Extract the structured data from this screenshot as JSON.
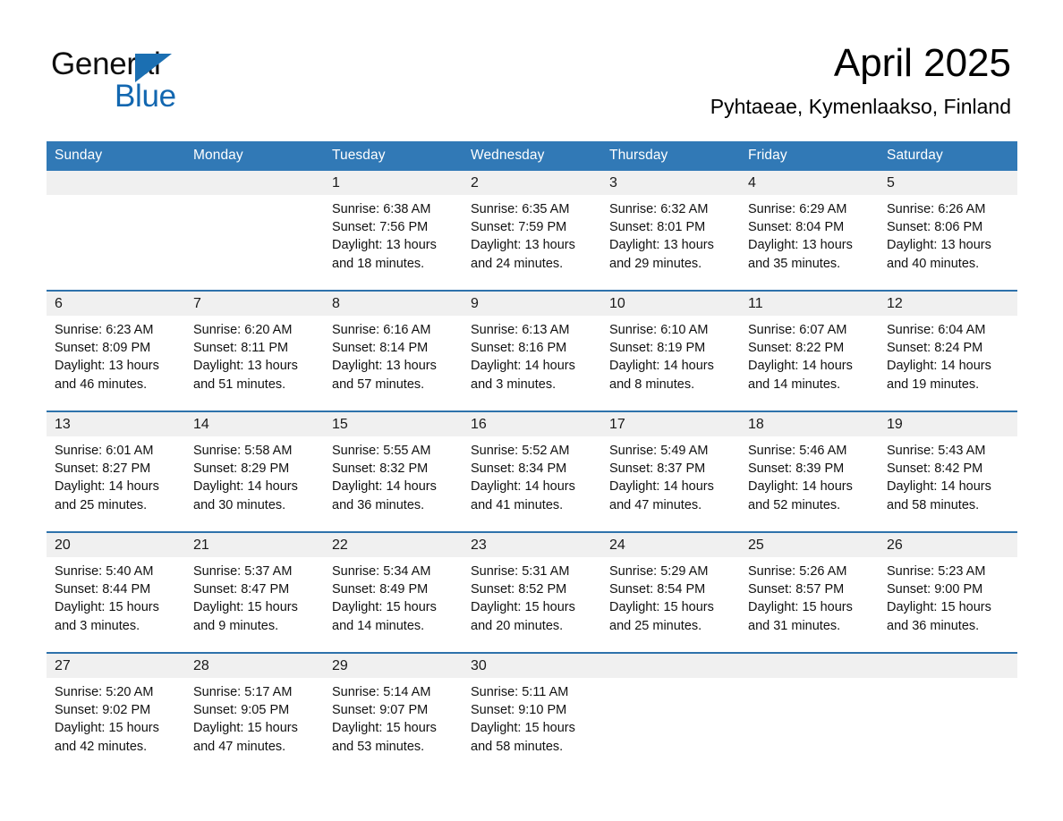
{
  "brand": {
    "name_part1": "General",
    "name_part2": "Blue",
    "accent_color": "#1267b0",
    "triangle_color": "#1b6fb2"
  },
  "header": {
    "month_title": "April 2025",
    "location": "Pyhtaeae, Kymenlaakso, Finland",
    "header_bar_color": "#3179b6",
    "row_divider_color": "#2e72ab",
    "daynum_band_color": "#f0f0f0"
  },
  "weekday_headers": [
    "Sunday",
    "Monday",
    "Tuesday",
    "Wednesday",
    "Thursday",
    "Friday",
    "Saturday"
  ],
  "weeks": [
    [
      {
        "day": "",
        "sunrise": "",
        "sunset": "",
        "daylight": "",
        "daylight2": ""
      },
      {
        "day": "",
        "sunrise": "",
        "sunset": "",
        "daylight": "",
        "daylight2": ""
      },
      {
        "day": "1",
        "sunrise": "Sunrise: 6:38 AM",
        "sunset": "Sunset: 7:56 PM",
        "daylight": "Daylight: 13 hours",
        "daylight2": "and 18 minutes."
      },
      {
        "day": "2",
        "sunrise": "Sunrise: 6:35 AM",
        "sunset": "Sunset: 7:59 PM",
        "daylight": "Daylight: 13 hours",
        "daylight2": "and 24 minutes."
      },
      {
        "day": "3",
        "sunrise": "Sunrise: 6:32 AM",
        "sunset": "Sunset: 8:01 PM",
        "daylight": "Daylight: 13 hours",
        "daylight2": "and 29 minutes."
      },
      {
        "day": "4",
        "sunrise": "Sunrise: 6:29 AM",
        "sunset": "Sunset: 8:04 PM",
        "daylight": "Daylight: 13 hours",
        "daylight2": "and 35 minutes."
      },
      {
        "day": "5",
        "sunrise": "Sunrise: 6:26 AM",
        "sunset": "Sunset: 8:06 PM",
        "daylight": "Daylight: 13 hours",
        "daylight2": "and 40 minutes."
      }
    ],
    [
      {
        "day": "6",
        "sunrise": "Sunrise: 6:23 AM",
        "sunset": "Sunset: 8:09 PM",
        "daylight": "Daylight: 13 hours",
        "daylight2": "and 46 minutes."
      },
      {
        "day": "7",
        "sunrise": "Sunrise: 6:20 AM",
        "sunset": "Sunset: 8:11 PM",
        "daylight": "Daylight: 13 hours",
        "daylight2": "and 51 minutes."
      },
      {
        "day": "8",
        "sunrise": "Sunrise: 6:16 AM",
        "sunset": "Sunset: 8:14 PM",
        "daylight": "Daylight: 13 hours",
        "daylight2": "and 57 minutes."
      },
      {
        "day": "9",
        "sunrise": "Sunrise: 6:13 AM",
        "sunset": "Sunset: 8:16 PM",
        "daylight": "Daylight: 14 hours",
        "daylight2": "and 3 minutes."
      },
      {
        "day": "10",
        "sunrise": "Sunrise: 6:10 AM",
        "sunset": "Sunset: 8:19 PM",
        "daylight": "Daylight: 14 hours",
        "daylight2": "and 8 minutes."
      },
      {
        "day": "11",
        "sunrise": "Sunrise: 6:07 AM",
        "sunset": "Sunset: 8:22 PM",
        "daylight": "Daylight: 14 hours",
        "daylight2": "and 14 minutes."
      },
      {
        "day": "12",
        "sunrise": "Sunrise: 6:04 AM",
        "sunset": "Sunset: 8:24 PM",
        "daylight": "Daylight: 14 hours",
        "daylight2": "and 19 minutes."
      }
    ],
    [
      {
        "day": "13",
        "sunrise": "Sunrise: 6:01 AM",
        "sunset": "Sunset: 8:27 PM",
        "daylight": "Daylight: 14 hours",
        "daylight2": "and 25 minutes."
      },
      {
        "day": "14",
        "sunrise": "Sunrise: 5:58 AM",
        "sunset": "Sunset: 8:29 PM",
        "daylight": "Daylight: 14 hours",
        "daylight2": "and 30 minutes."
      },
      {
        "day": "15",
        "sunrise": "Sunrise: 5:55 AM",
        "sunset": "Sunset: 8:32 PM",
        "daylight": "Daylight: 14 hours",
        "daylight2": "and 36 minutes."
      },
      {
        "day": "16",
        "sunrise": "Sunrise: 5:52 AM",
        "sunset": "Sunset: 8:34 PM",
        "daylight": "Daylight: 14 hours",
        "daylight2": "and 41 minutes."
      },
      {
        "day": "17",
        "sunrise": "Sunrise: 5:49 AM",
        "sunset": "Sunset: 8:37 PM",
        "daylight": "Daylight: 14 hours",
        "daylight2": "and 47 minutes."
      },
      {
        "day": "18",
        "sunrise": "Sunrise: 5:46 AM",
        "sunset": "Sunset: 8:39 PM",
        "daylight": "Daylight: 14 hours",
        "daylight2": "and 52 minutes."
      },
      {
        "day": "19",
        "sunrise": "Sunrise: 5:43 AM",
        "sunset": "Sunset: 8:42 PM",
        "daylight": "Daylight: 14 hours",
        "daylight2": "and 58 minutes."
      }
    ],
    [
      {
        "day": "20",
        "sunrise": "Sunrise: 5:40 AM",
        "sunset": "Sunset: 8:44 PM",
        "daylight": "Daylight: 15 hours",
        "daylight2": "and 3 minutes."
      },
      {
        "day": "21",
        "sunrise": "Sunrise: 5:37 AM",
        "sunset": "Sunset: 8:47 PM",
        "daylight": "Daylight: 15 hours",
        "daylight2": "and 9 minutes."
      },
      {
        "day": "22",
        "sunrise": "Sunrise: 5:34 AM",
        "sunset": "Sunset: 8:49 PM",
        "daylight": "Daylight: 15 hours",
        "daylight2": "and 14 minutes."
      },
      {
        "day": "23",
        "sunrise": "Sunrise: 5:31 AM",
        "sunset": "Sunset: 8:52 PM",
        "daylight": "Daylight: 15 hours",
        "daylight2": "and 20 minutes."
      },
      {
        "day": "24",
        "sunrise": "Sunrise: 5:29 AM",
        "sunset": "Sunset: 8:54 PM",
        "daylight": "Daylight: 15 hours",
        "daylight2": "and 25 minutes."
      },
      {
        "day": "25",
        "sunrise": "Sunrise: 5:26 AM",
        "sunset": "Sunset: 8:57 PM",
        "daylight": "Daylight: 15 hours",
        "daylight2": "and 31 minutes."
      },
      {
        "day": "26",
        "sunrise": "Sunrise: 5:23 AM",
        "sunset": "Sunset: 9:00 PM",
        "daylight": "Daylight: 15 hours",
        "daylight2": "and 36 minutes."
      }
    ],
    [
      {
        "day": "27",
        "sunrise": "Sunrise: 5:20 AM",
        "sunset": "Sunset: 9:02 PM",
        "daylight": "Daylight: 15 hours",
        "daylight2": "and 42 minutes."
      },
      {
        "day": "28",
        "sunrise": "Sunrise: 5:17 AM",
        "sunset": "Sunset: 9:05 PM",
        "daylight": "Daylight: 15 hours",
        "daylight2": "and 47 minutes."
      },
      {
        "day": "29",
        "sunrise": "Sunrise: 5:14 AM",
        "sunset": "Sunset: 9:07 PM",
        "daylight": "Daylight: 15 hours",
        "daylight2": "and 53 minutes."
      },
      {
        "day": "30",
        "sunrise": "Sunrise: 5:11 AM",
        "sunset": "Sunset: 9:10 PM",
        "daylight": "Daylight: 15 hours",
        "daylight2": "and 58 minutes."
      },
      {
        "day": "",
        "sunrise": "",
        "sunset": "",
        "daylight": "",
        "daylight2": ""
      },
      {
        "day": "",
        "sunrise": "",
        "sunset": "",
        "daylight": "",
        "daylight2": ""
      },
      {
        "day": "",
        "sunrise": "",
        "sunset": "",
        "daylight": "",
        "daylight2": ""
      }
    ]
  ]
}
